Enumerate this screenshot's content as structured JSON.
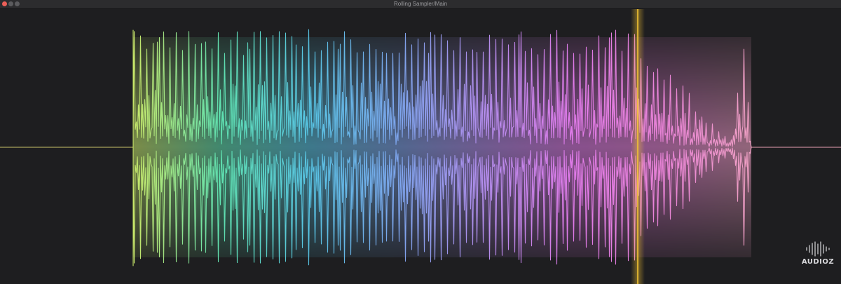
{
  "window": {
    "title": "Rolling Sampler/Main"
  },
  "colors": {
    "background": "#1e1e20",
    "titlebar": "#2c2c2e",
    "playhead": "#f1c232",
    "waveform_gradient": [
      "#c8e86a",
      "#5fe0b0",
      "#58c4e4",
      "#7da4ec",
      "#b48cec",
      "#e07ae8",
      "#ea84d8",
      "#f0a0c4"
    ]
  },
  "waveform": {
    "playhead_position": 0.61
  },
  "watermark": {
    "text": "AUDIOZ"
  }
}
